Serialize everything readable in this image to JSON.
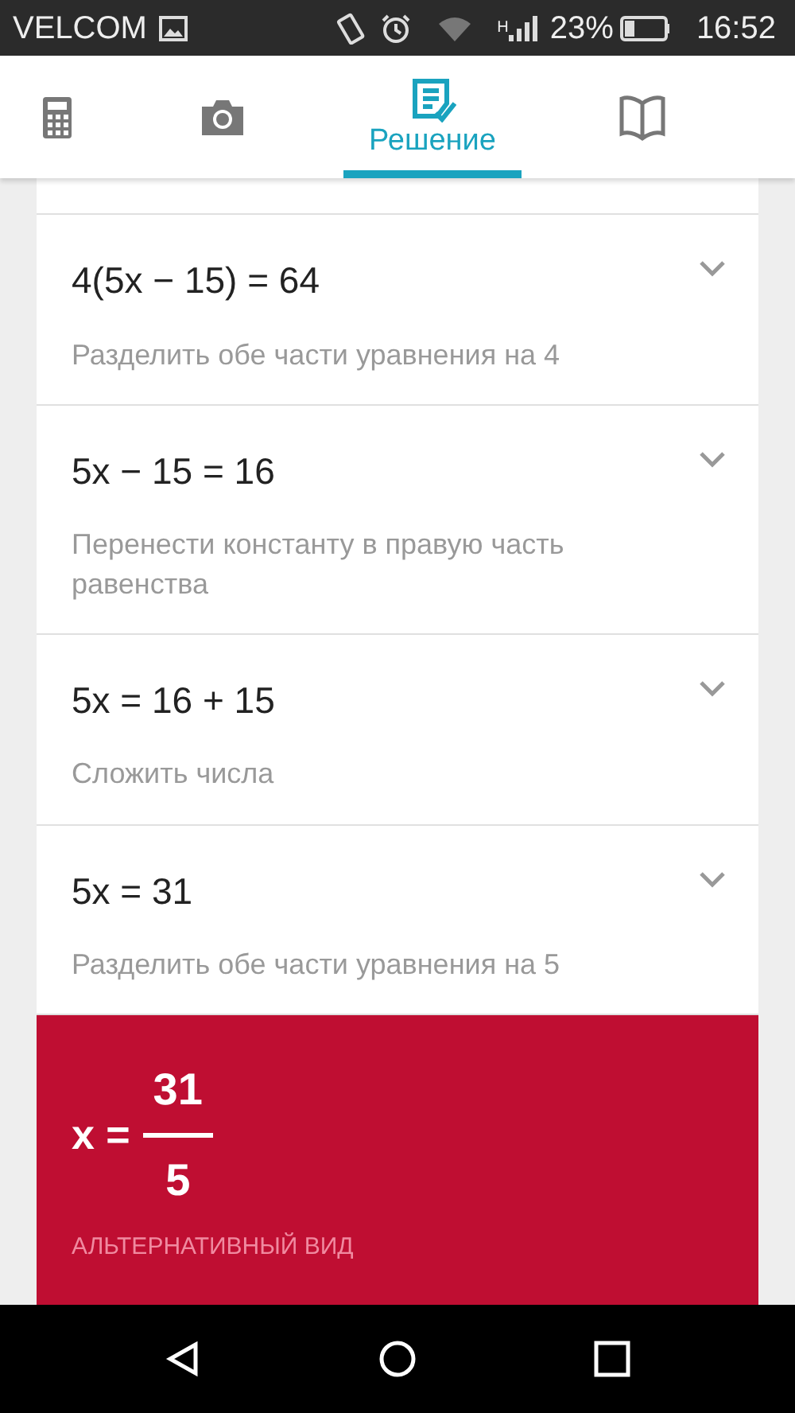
{
  "status_bar": {
    "carrier": "VELCOM",
    "network": "H",
    "battery": "23%",
    "time": "16:52"
  },
  "tabs": [
    {
      "kind": "calculator",
      "selected": false
    },
    {
      "kind": "camera",
      "selected": false
    },
    {
      "kind": "solution",
      "label": "Решение",
      "selected": true
    },
    {
      "kind": "book",
      "selected": false
    }
  ],
  "steps": [
    {
      "equation": "4(5x − 15) = 64",
      "hint": "Разделить обе части уравнения на 4",
      "expanded": false
    },
    {
      "equation": "5x − 15 = 16",
      "hint": "Перенести константу в правую часть равенства",
      "expanded": false
    },
    {
      "equation": "5x = 16 + 15",
      "hint": "Сложить числа",
      "expanded": false
    },
    {
      "equation": "5x = 31",
      "hint": "Разделить обе части уравнения на 5",
      "expanded": false
    }
  ],
  "result": {
    "lhs": "x =",
    "numerator": "31",
    "denominator": "5",
    "link": "АЛЬТЕРНАТИВНЫЙ ВИД"
  }
}
